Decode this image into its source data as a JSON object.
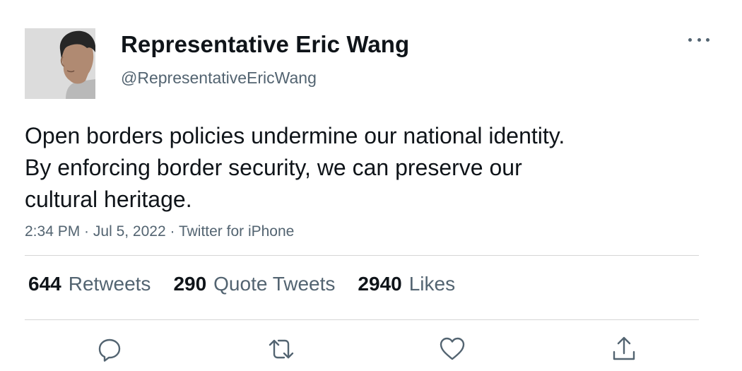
{
  "user": {
    "display_name": "Representative Eric Wang",
    "handle": "@RepresentativeEricWang"
  },
  "tweet": {
    "lines": [
      "Open borders policies undermine our national identity.",
      "By enforcing border security, we can preserve our",
      "cultural heritage."
    ],
    "time": "2:34 PM",
    "date": "Jul 5, 2022",
    "source": "Twitter for iPhone",
    "separator": " · "
  },
  "stats": {
    "retweets_count": "644",
    "retweets_label": "Retweets",
    "quotes_count": "290",
    "quotes_label": "Quote Tweets",
    "likes_count": "2940",
    "likes_label": "Likes"
  },
  "icons": {
    "more": "more-horizontal-icon",
    "reply": "reply-icon",
    "retweet": "retweet-icon",
    "like": "heart-icon",
    "share": "share-icon"
  },
  "colors": {
    "text": "#0f1419",
    "secondary": "#536471",
    "divider": "#d6d6d6"
  }
}
